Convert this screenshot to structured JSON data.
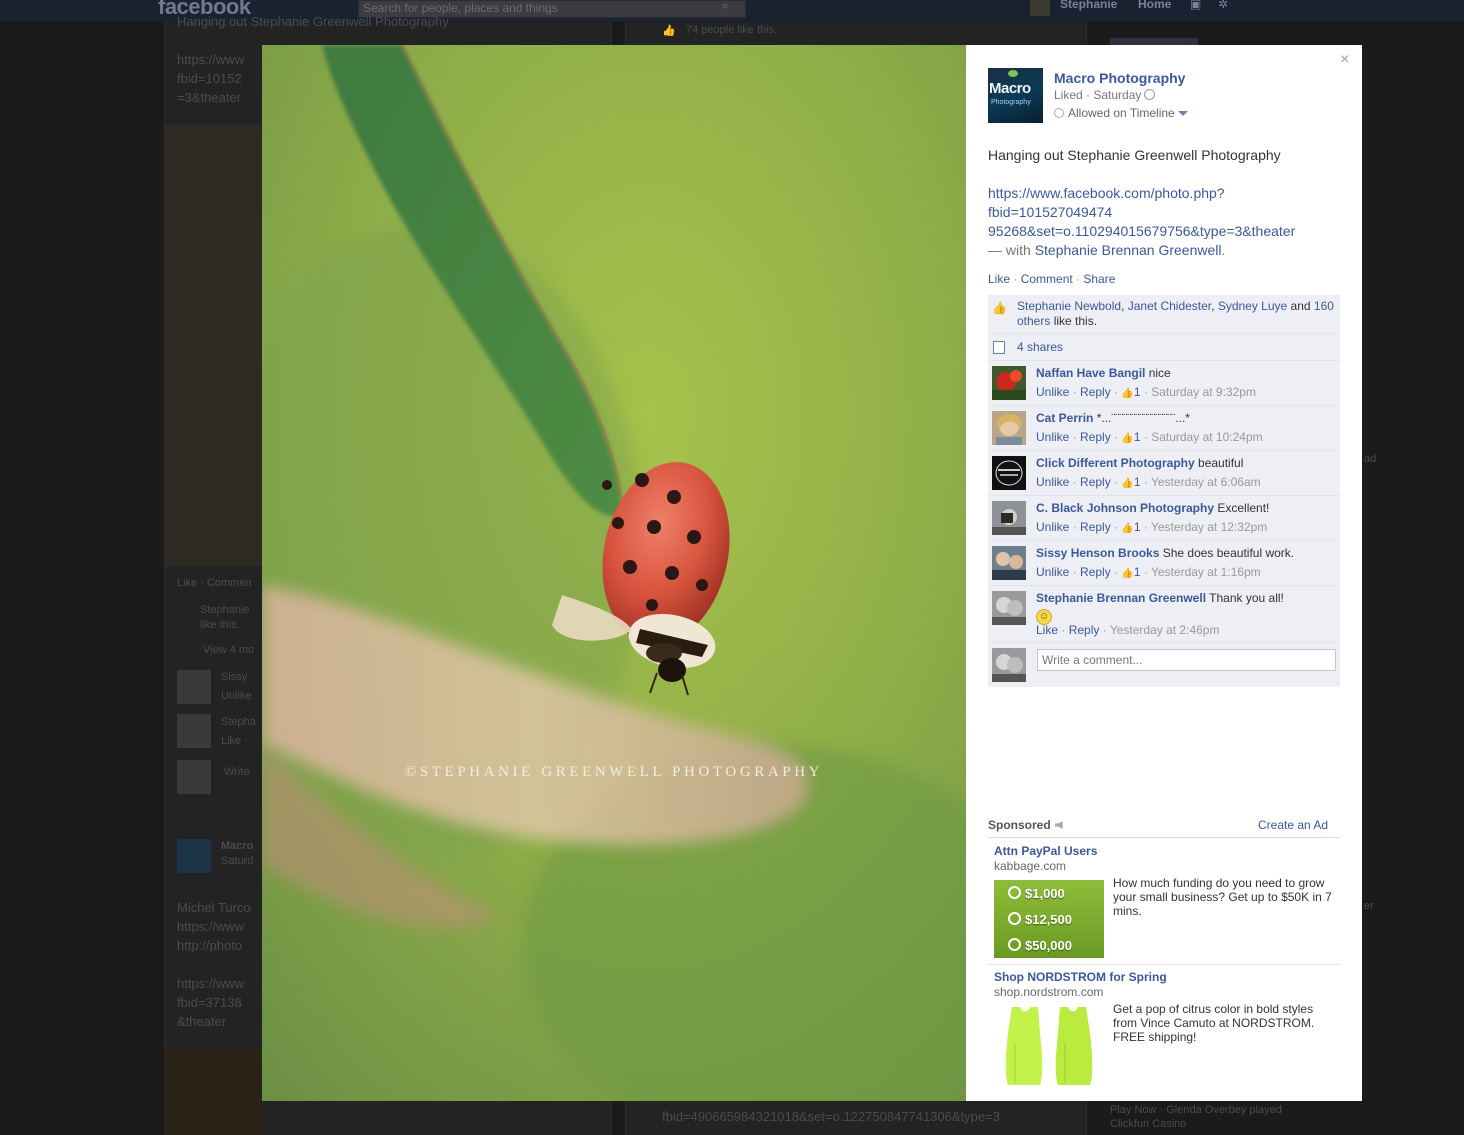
{
  "background_page": {
    "logo": "facebook",
    "search_placeholder": "Search for people, places and things",
    "user_name": "Stephanie",
    "home_label": "Home",
    "post_header": "Hanging out Stephanie Greenwell Photography",
    "post_link_lines": [
      "https://www",
      "fbid=10152",
      "=3&theater"
    ],
    "likes_count_text": "74 people like this.",
    "like_comment": "Like · Commen",
    "liker": "Stephanie",
    "like_this": "like this.",
    "view_more": "View 4 mo",
    "c1": "Sissy",
    "c1_sub": "Unlike",
    "c2": "Stepha",
    "c2_sub": "Like ·",
    "write": "Write",
    "post2_name": "Macro",
    "post2_date": "Saturd",
    "post2_lines": [
      "Michel Turco",
      "https://www",
      "http://photo",
      "",
      "https://www",
      "fbid=37138",
      "&theater"
    ],
    "bottom_right_lines": [
      "fbid=490665984321018&set=o.122750847741306&type=3"
    ],
    "ticker_text": "Play Now · Glenda Overbey played",
    "ticker_sub": "Clickfun Casino",
    "right_edge_1": "ad",
    "right_edge_2": "er"
  },
  "photo": {
    "watermark": "©STEPHANIE GREENWELL PHOTOGRAPHY"
  },
  "side": {
    "close": "×",
    "page_logo_word": "Macro",
    "page_logo_sub": "Photography",
    "page_name": "Macro Photography",
    "liked_meta": "Liked · Saturday",
    "timeline": "Allowed on Timeline",
    "caption": "Hanging out Stephanie Greenwell Photography",
    "link_lines": [
      "https://www.facebook.com/photo.php?",
      "fbid=101527049474",
      "95268&set=o.110294015679756&type=3&theater"
    ],
    "with_prefix": "— with ",
    "with_name": "Stephanie Brennan Greenwell",
    "with_suffix": ".",
    "actions": {
      "like": "Like",
      "comment": "Comment",
      "share": "Share",
      "sep": " · "
    },
    "likes": {
      "names": [
        "Stephanie Newbold",
        "Janet Chidester",
        "Sydney Luye"
      ],
      "and": " and ",
      "others": "160 others",
      "suffix": " like this."
    },
    "shares": "4 shares",
    "comments": [
      {
        "name": "Naffan Have Bangil",
        "text": " nice",
        "action": "Unlike",
        "reply": "Reply",
        "likes": "1",
        "time": "Saturday at 9:32pm"
      },
      {
        "name": "Cat Perrin",
        "text": " *...¨¨¨¨¨¨¨¨¨¨¨¨¨¨¨¨...*",
        "action": "Unlike",
        "reply": "Reply",
        "likes": "1",
        "time": "Saturday at 10:24pm"
      },
      {
        "name": "Click Different Photography",
        "text": " beautiful",
        "action": "Unlike",
        "reply": "Reply",
        "likes": "1",
        "time": "Yesterday at 6:06am"
      },
      {
        "name": "C. Black Johnson Photography",
        "text": " Excellent!",
        "action": "Unlike",
        "reply": "Reply",
        "likes": "1",
        "time": "Yesterday at 12:32pm"
      },
      {
        "name": "Sissy Henson Brooks",
        "text": " She does beautiful work.",
        "action": "Unlike",
        "reply": "Reply",
        "likes": "1",
        "time": "Yesterday at 1:16pm"
      },
      {
        "name": "Stephanie Brennan Greenwell",
        "text": " Thank you all!",
        "action": "Like",
        "reply": "Reply",
        "time": "Yesterday at 2:46pm"
      }
    ],
    "write_placeholder": "Write a comment...",
    "sponsored": "Sponsored",
    "create_ad": "Create an Ad",
    "ads": [
      {
        "title": "Attn PayPal Users",
        "domain": "kabbage.com",
        "body": "How much funding do you need to grow your small business? Get up to $50K in 7 mins.",
        "amounts": [
          "$1,000",
          "$12,500",
          "$50,000"
        ]
      },
      {
        "title": "Shop NORDSTROM for Spring",
        "domain": "shop.nordstrom.com",
        "body": "Get a pop of citrus color in bold styles from Vince Camuto at NORDSTROM. FREE shipping!"
      }
    ]
  }
}
